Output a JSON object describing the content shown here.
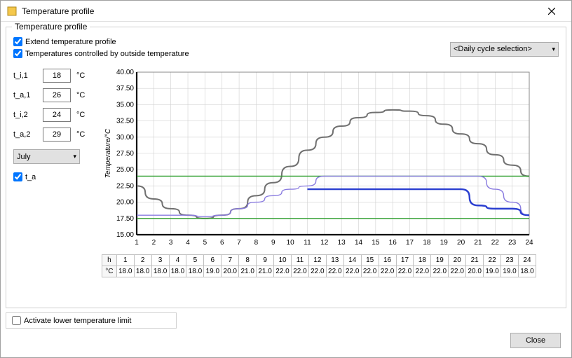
{
  "window": {
    "title": "Temperature profile"
  },
  "group": {
    "title": "Temperature profile"
  },
  "options": {
    "extend_label": "Extend temperature profile",
    "controlled_label": "Temperatures controlled by outside temperature",
    "daily_cycle_label": "<Daily cycle selection>"
  },
  "inputs": {
    "ti1": {
      "label": "t_i,1",
      "value": "18",
      "unit": "°C"
    },
    "ta1": {
      "label": "t_a,1",
      "value": "26",
      "unit": "°C"
    },
    "ti2": {
      "label": "t_i,2",
      "value": "24",
      "unit": "°C"
    },
    "ta2": {
      "label": "t_a,2",
      "value": "29",
      "unit": "°C"
    },
    "month": "July",
    "ta_chk": "t_a"
  },
  "lower_limit": {
    "label": "Activate lower temperature limit"
  },
  "footer": {
    "close": "Close"
  },
  "table": {
    "row1_hdr": "h",
    "row2_hdr": "°C",
    "hours": [
      "1",
      "2",
      "3",
      "4",
      "5",
      "6",
      "7",
      "8",
      "9",
      "10",
      "11",
      "12",
      "13",
      "14",
      "15",
      "16",
      "17",
      "18",
      "19",
      "20",
      "21",
      "22",
      "23",
      "24"
    ],
    "temps": [
      "18.0",
      "18.0",
      "18.0",
      "18.0",
      "18.0",
      "19.0",
      "20.0",
      "21.0",
      "21.0",
      "22.0",
      "22.0",
      "22.0",
      "22.0",
      "22.0",
      "22.0",
      "22.0",
      "22.0",
      "22.0",
      "22.0",
      "22.0",
      "20.0",
      "19.0",
      "19.0",
      "18.0"
    ]
  },
  "chart_data": {
    "type": "line",
    "title": "",
    "xlabel": "",
    "ylabel": "Temperature/°C",
    "xlim": [
      1,
      24
    ],
    "ylim": [
      15,
      40
    ],
    "xticks": [
      1,
      2,
      3,
      4,
      5,
      6,
      7,
      8,
      9,
      10,
      11,
      12,
      13,
      14,
      15,
      16,
      17,
      18,
      19,
      20,
      21,
      22,
      23,
      24
    ],
    "yticks": [
      15.0,
      17.5,
      20.0,
      22.5,
      25.0,
      27.5,
      30.0,
      32.5,
      35.0,
      37.5,
      40.0
    ],
    "series": [
      {
        "name": "t_a (outside)",
        "color": "#707070",
        "x": [
          1,
          2,
          3,
          4,
          5,
          6,
          7,
          8,
          9,
          10,
          11,
          12,
          13,
          14,
          15,
          16,
          17,
          18,
          19,
          20,
          21,
          22,
          23,
          24
        ],
        "values": [
          22.5,
          20.5,
          19.0,
          18.0,
          17.5,
          18.0,
          19.0,
          21.0,
          23.0,
          25.5,
          28.0,
          30.0,
          31.7,
          33.0,
          33.8,
          34.2,
          34.0,
          33.3,
          32.0,
          30.5,
          29.0,
          27.3,
          25.7,
          24.0
        ]
      },
      {
        "name": "upper green",
        "color": "#2e9e2e",
        "x": [
          1,
          24
        ],
        "values": [
          24.0,
          24.0
        ]
      },
      {
        "name": "lower green",
        "color": "#2e9e2e",
        "x": [
          1,
          24
        ],
        "values": [
          17.5,
          17.5
        ]
      },
      {
        "name": "violet profile",
        "color": "#8a7ce0",
        "x": [
          1,
          2,
          3,
          4,
          5,
          6,
          7,
          8,
          9,
          10,
          11,
          12,
          13,
          14,
          15,
          16,
          17,
          18,
          19,
          20,
          21,
          22,
          23,
          24
        ],
        "values": [
          18.0,
          18.0,
          18.0,
          18.0,
          17.8,
          18.0,
          19.0,
          20.0,
          21.0,
          22.0,
          22.5,
          24.0,
          24.0,
          24.0,
          24.0,
          24.0,
          24.0,
          24.0,
          24.0,
          24.0,
          24.0,
          22.0,
          20.0,
          18.0
        ]
      },
      {
        "name": "blue setpoint",
        "color": "#2a3ed0",
        "x": [
          11,
          12,
          13,
          14,
          15,
          16,
          17,
          18,
          19,
          20,
          21,
          22,
          23,
          24
        ],
        "values": [
          22.0,
          22.0,
          22.0,
          22.0,
          22.0,
          22.0,
          22.0,
          22.0,
          22.0,
          22.0,
          19.5,
          19.0,
          19.0,
          18.0
        ]
      }
    ]
  }
}
